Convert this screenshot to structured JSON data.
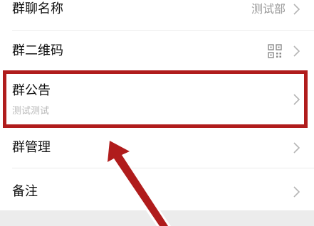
{
  "settings": {
    "rows": [
      {
        "label": "群聊名称",
        "value": "测试部"
      },
      {
        "label": "群二维码",
        "icon": "qr-code-icon"
      },
      {
        "label": "群公告",
        "subtitle": "测试测试"
      },
      {
        "label": "群管理"
      },
      {
        "label": "备注"
      }
    ]
  },
  "annotation": {
    "box_color": "#b01c1c",
    "arrow_color": "#b01c1c"
  }
}
